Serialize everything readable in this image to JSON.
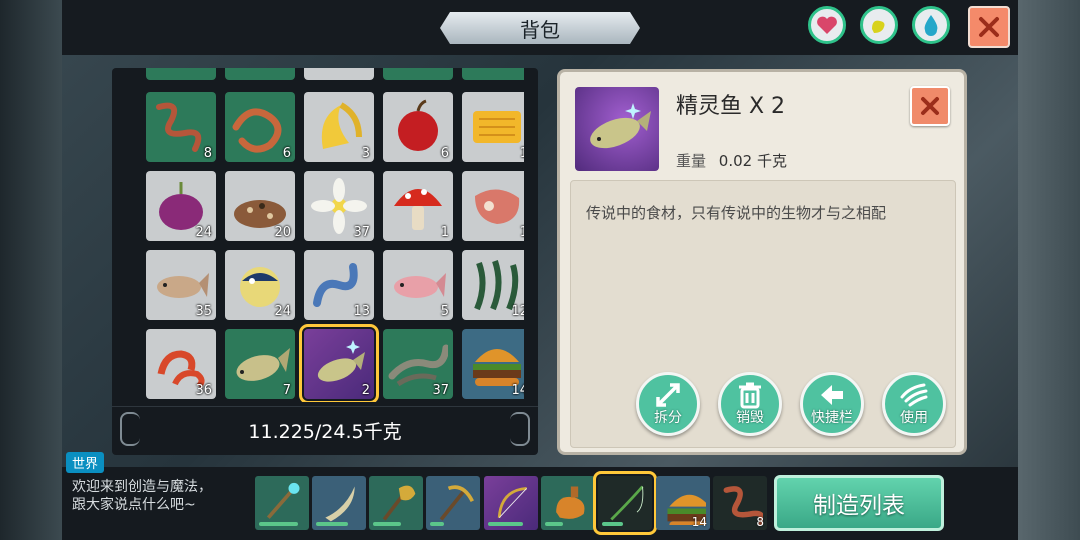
{
  "header": {
    "title": "背包",
    "stats": [
      {
        "icon": "heart-icon",
        "color": "#d9466a"
      },
      {
        "icon": "stomach-icon",
        "color": "#d8d21c"
      },
      {
        "icon": "water-drop-icon",
        "color": "#24a7c9"
      }
    ]
  },
  "inventory": {
    "slots": [
      {
        "icon": "earthworm-icon",
        "count": "8",
        "bg": "green"
      },
      {
        "icon": "worm-icon",
        "count": "6",
        "bg": "green"
      },
      {
        "icon": "banana-icon",
        "count": "3",
        "bg": "gray"
      },
      {
        "icon": "apple-icon",
        "count": "6",
        "bg": "gray"
      },
      {
        "icon": "honeycomb-icon",
        "count": "1",
        "bg": "gray"
      },
      {
        "icon": "onion-icon",
        "count": "24",
        "bg": "gray"
      },
      {
        "icon": "seeds-icon",
        "count": "20",
        "bg": "gray"
      },
      {
        "icon": "lotus-flower-icon",
        "count": "37",
        "bg": "gray"
      },
      {
        "icon": "mushroom-icon",
        "count": "1",
        "bg": "gray"
      },
      {
        "icon": "raw-meat-icon",
        "count": "1",
        "bg": "gray"
      },
      {
        "icon": "fish-icon",
        "count": "35",
        "bg": "gray"
      },
      {
        "icon": "pufferfish-icon",
        "count": "24",
        "bg": "gray"
      },
      {
        "icon": "eel-icon",
        "count": "13",
        "bg": "gray"
      },
      {
        "icon": "pink-fish-icon",
        "count": "5",
        "bg": "gray"
      },
      {
        "icon": "seaweed-icon",
        "count": "12",
        "bg": "gray"
      },
      {
        "icon": "shrimp-icon",
        "count": "36",
        "bg": "gray"
      },
      {
        "icon": "yellow-fish-icon",
        "count": "7",
        "bg": "green"
      },
      {
        "icon": "spirit-fish-icon",
        "count": "2",
        "bg": "purple",
        "selected": true
      },
      {
        "icon": "eel-green-icon",
        "count": "37",
        "bg": "green"
      },
      {
        "icon": "burger-icon",
        "count": "14",
        "bg": "blue"
      }
    ],
    "weight": "11.225/24.5千克"
  },
  "detail": {
    "name": "精灵鱼 X 2",
    "weight_label": "重量",
    "weight_value": "0.02 千克",
    "description": "传说中的食材，只有传说中的生物才与之相配",
    "actions": [
      {
        "label": "拆分",
        "icon": "split-arrows-icon"
      },
      {
        "label": "销毁",
        "icon": "trash-icon"
      },
      {
        "label": "快捷栏",
        "icon": "arrow-left-icon"
      },
      {
        "label": "使用",
        "icon": "hand-icon"
      }
    ]
  },
  "chat": {
    "channel": "世界",
    "line1": "欢迎来到创造与魔法，",
    "line2": "跟大家说点什么吧~"
  },
  "hotbar": {
    "slots": [
      {
        "icon": "magic-staff-icon",
        "bg": "teal",
        "durability": 0.85
      },
      {
        "icon": "scimitar-icon",
        "bg": "blue",
        "durability": 0.7
      },
      {
        "icon": "battle-axe-icon",
        "bg": "teal",
        "durability": 0.6
      },
      {
        "icon": "pickaxe-icon",
        "bg": "blue",
        "durability": 0.3
      },
      {
        "icon": "bow-icon",
        "bg": "purple",
        "durability": 0.75
      },
      {
        "icon": "flask-icon",
        "bg": "teal",
        "durability": 0.4
      },
      {
        "icon": "fishing-rod-icon",
        "bg": "dark",
        "durability": 0.45,
        "selected": true
      },
      {
        "icon": "burger-icon",
        "bg": "blue",
        "count": "14"
      },
      {
        "icon": "earthworm-icon",
        "bg": "dark",
        "count": "8"
      }
    ],
    "craft_label": "制造列表"
  }
}
